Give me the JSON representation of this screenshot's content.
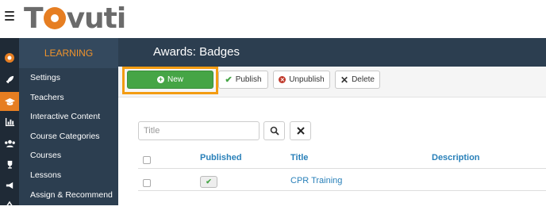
{
  "brand": {
    "logo_prefix": "T",
    "logo_suffix": "vuti",
    "accent": "#e67e22",
    "sidebar_bg": "#2c3e50",
    "new_button_color": "#46a546",
    "highlight_color": "#f39c12"
  },
  "sidebar": {
    "section_title": "LEARNING",
    "items": [
      {
        "label": "Settings"
      },
      {
        "label": "Teachers"
      },
      {
        "label": "Interactive Content"
      },
      {
        "label": "Course Categories"
      },
      {
        "label": "Courses"
      },
      {
        "label": "Lessons"
      },
      {
        "label": "Assign & Recommend"
      }
    ],
    "icons": [
      "brand-icon",
      "rocket-icon",
      "graduation-cap-icon",
      "bar-chart-icon",
      "users-icon",
      "trophy-icon",
      "megaphone-icon",
      "more-icon"
    ]
  },
  "header": {
    "title": "Awards: Badges"
  },
  "toolbar": {
    "new_label": "New",
    "publish_label": "Publish",
    "unpublish_label": "Unpublish",
    "delete_label": "Delete"
  },
  "search": {
    "placeholder": "Title",
    "value": ""
  },
  "table": {
    "columns": [
      "Published",
      "Title",
      "Description"
    ],
    "rows": [
      {
        "published": true,
        "title": "CPR Training",
        "description": ""
      }
    ]
  }
}
